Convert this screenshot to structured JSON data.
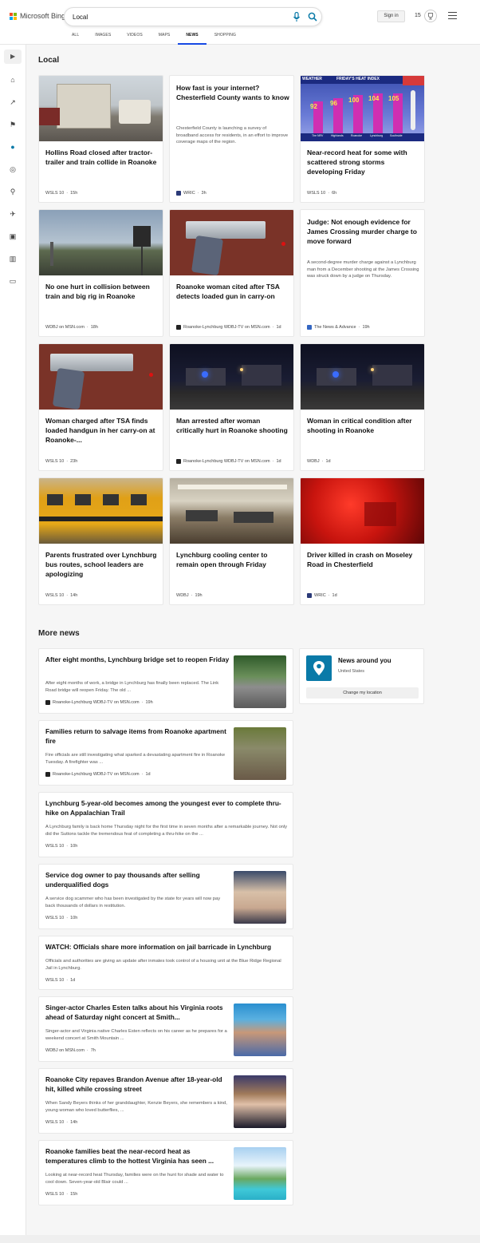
{
  "header": {
    "logo_text": "Microsoft Bing",
    "search_value": "Local",
    "signin": "Sign in",
    "points": "15"
  },
  "tabs": [
    "ALL",
    "IMAGES",
    "VIDEOS",
    "MAPS",
    "NEWS",
    "SHOPPING"
  ],
  "active_tab": "NEWS",
  "local": {
    "heading": "Local",
    "cards": [
      {
        "title": "Hollins Road closed after tractor-trailer and train collide in Roanoke",
        "source": "WSLS 10",
        "time": "15h"
      },
      {
        "title": "How fast is your internet? Chesterfield County wants to know",
        "snippet": "Chesterfield County is launching a survey of broadband access for residents, in an effort to improve coverage maps of the region.",
        "source": "WRIC",
        "time": "3h"
      },
      {
        "title": "Near-record heat for some with scattered strong storms developing Friday",
        "source": "WSLS 10",
        "time": "6h",
        "img_caption": "FRIDAY'S HEAT INDEX",
        "img_values": [
          "92",
          "96",
          "100",
          "104",
          "105"
        ],
        "img_labels": [
          "The NRV",
          "Highlands",
          "Roanoke",
          "Lynchburg",
          "Southside"
        ],
        "img_brand": "WEATHER"
      },
      {
        "title": "No one hurt in collision between train and big rig in Roanoke",
        "source": "WDBJ on MSN.com",
        "time": "18h"
      },
      {
        "title": "Roanoke woman cited after TSA detects loaded gun in carry-on",
        "source": "Roanoke-Lynchburg WDBJ-TV on MSN.com",
        "time": "1d"
      },
      {
        "title": "Judge: Not enough evidence for James Crossing murder charge to move forward",
        "snippet": "A second-degree murder charge against a Lynchburg man from a December shooting at the James Crossing was struck down by a judge on Thursday.",
        "source": "The News & Advance",
        "time": "19h"
      },
      {
        "title": "Woman charged after TSA finds loaded handgun in her carry-on at Roanoke-...",
        "source": "WSLS 10",
        "time": "23h"
      },
      {
        "title": "Man arrested after woman critically hurt in Roanoke shooting",
        "source": "Roanoke-Lynchburg WDBJ-TV on MSN.com",
        "time": "1d"
      },
      {
        "title": "Woman in critical condition after shooting in Roanoke",
        "source": "WDBJ",
        "time": "1d"
      },
      {
        "title": "Parents frustrated over Lynchburg bus routes, school leaders are apologizing",
        "source": "WSLS 10",
        "time": "14h"
      },
      {
        "title": "Lynchburg cooling center to remain open through Friday",
        "source": "WDBJ",
        "time": "19h"
      },
      {
        "title": "Driver killed in crash on Moseley Road in Chesterfield",
        "source": "WRIC",
        "time": "1d"
      }
    ]
  },
  "more_news": {
    "heading": "More news",
    "items": [
      {
        "title": "After eight months, Lynchburg bridge set to reopen Friday",
        "snippet": "After eight months of work, a bridge in Lynchburg has finally been replaced. The Link Road bridge will reopen Friday. The old ...",
        "source": "Roanoke-Lynchburg WDBJ-TV on MSN.com",
        "time": "19h"
      },
      {
        "title": "Families return to salvage items from Roanoke apartment fire",
        "snippet": "Fire officials are still investigating what sparked a devastating apartment fire in Roanoke Tuesday. A firefighter was ...",
        "source": "Roanoke-Lynchburg WDBJ-TV on MSN.com",
        "time": "1d"
      },
      {
        "title": "Lynchburg 5-year-old becomes among the youngest ever to complete thru-hike on Appalachian Trail",
        "snippet": "A Lynchburg family is back home Thursday night for the first time in seven months after a remarkable journey. Not only did the Suttons tackle the tremendous feat of completing a thru-hike on the ...",
        "source": "WSLS 10",
        "time": "10h"
      },
      {
        "title": "Service dog owner to pay thousands after selling underqualified dogs",
        "snippet": "A service dog scammer who has been investigated by the state for years will now pay back thousands of dollars in restitution.",
        "source": "WSLS 10",
        "time": "10h"
      },
      {
        "title": "WATCH: Officials share more information on jail barricade in Lynchburg",
        "snippet": "Officials and authorities are giving an update after inmates took control of a housing unit at the Blue Ridge Regional Jail in Lynchburg.",
        "source": "WSLS 10",
        "time": "1d"
      },
      {
        "title": "Singer-actor Charles Esten talks about his Virginia roots ahead of Saturday night concert at Smith...",
        "snippet": "Singer-actor and Virginia native Charles Esten reflects on his career as he prepares for a weekend concert at Smith Mountain ...",
        "source": "WDBJ on MSN.com",
        "time": "7h"
      },
      {
        "title": "Roanoke City repaves Brandon Avenue after 18-year-old hit, killed while crossing street",
        "snippet": "When Sandy Beyers thinks of her granddaughter, Kenzie Beyers, she remembers a kind, young woman who loved butterflies, ...",
        "source": "WSLS 10",
        "time": "14h"
      },
      {
        "title": "Roanoke families beat the near-record heat as temperatures climb to the hottest Virginia has seen ...",
        "snippet": "Looking at near-record heat Thursday, families were on the hunt for shade and water to cool down. Seven-year-old Blair could ...",
        "source": "WSLS 10",
        "time": "15h"
      }
    ]
  },
  "news_around": {
    "title": "News around you",
    "subtitle": "United States",
    "button": "Change my location"
  },
  "colors": {
    "accent": "#174ae4",
    "pin": "#0a7aa8",
    "rail_active": "#0a7aa8"
  }
}
